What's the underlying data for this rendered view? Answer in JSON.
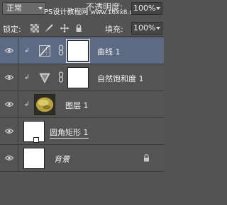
{
  "toolbar": {
    "blend_mode": "正常",
    "watermark": "PS设计教程网",
    "watermark_site": "www.16xx8.com",
    "opacity_label": "不透明度:",
    "opacity_value": "100%",
    "lock_label": "锁定:",
    "fill_label": "填充:",
    "fill_value": "100%",
    "lock_icons": [
      "lock-transparent-icon",
      "lock-image-icon",
      "lock-position-icon",
      "lock-all-icon"
    ]
  },
  "layers": [
    {
      "name": "曲线 1",
      "type": "adjustment",
      "icon": "curves-icon",
      "clipped": true,
      "selected": true,
      "visible": true
    },
    {
      "name": "自然饱和度 1",
      "type": "adjustment",
      "icon": "vibrance-icon",
      "clipped": true,
      "selected": false,
      "visible": true
    },
    {
      "name": "图层 1",
      "type": "pixel",
      "icon": "photo-thumbnail",
      "clipped": true,
      "selected": false,
      "visible": true
    },
    {
      "name": "圆角矩形 1",
      "type": "shape",
      "icon": "shape-thumbnail",
      "clipped": false,
      "selected": false,
      "visible": true
    },
    {
      "name": "背景",
      "type": "background",
      "icon": "background-thumbnail",
      "clipped": false,
      "selected": false,
      "visible": true,
      "locked": true
    }
  ],
  "colors": {
    "panel_bg": "#535353",
    "selected_bg": "#5c6b83",
    "divider": "#3c3c3c"
  }
}
